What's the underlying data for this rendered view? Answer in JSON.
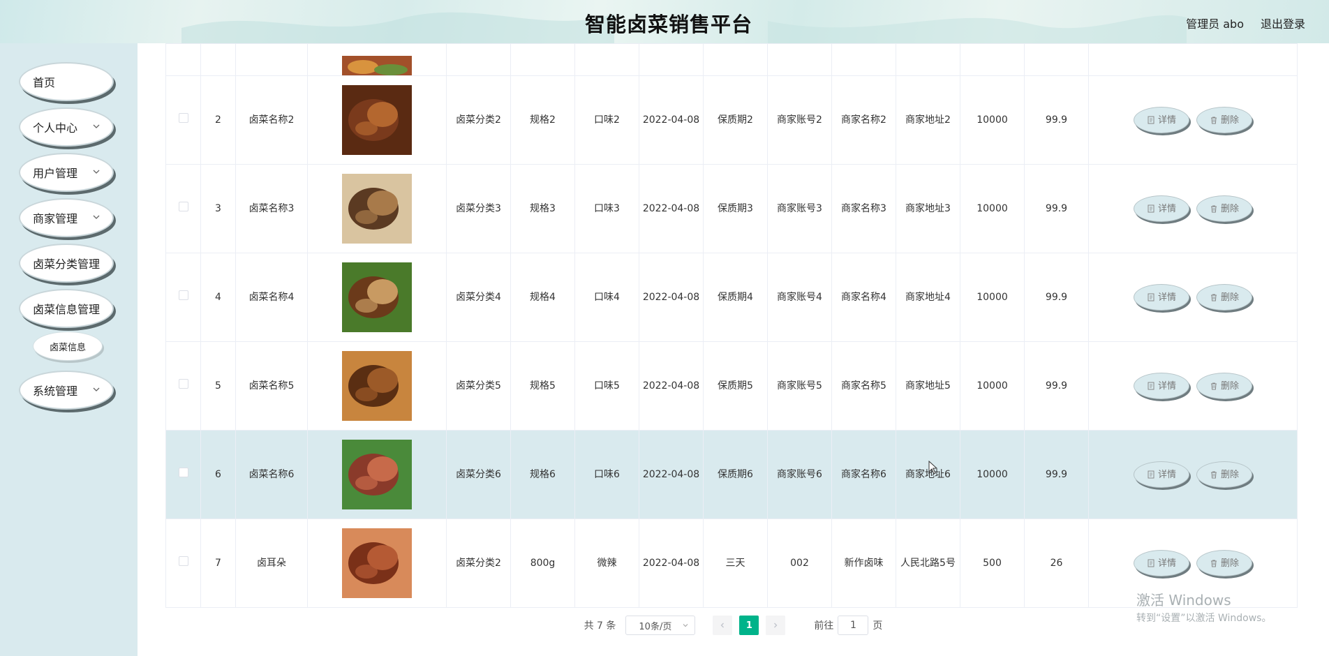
{
  "header": {
    "title": "智能卤菜销售平台",
    "user_label": "管理员 abo",
    "logout": "退出登录"
  },
  "sidebar": {
    "items": [
      {
        "label": "首页",
        "has_arrow": false
      },
      {
        "label": "个人中心",
        "has_arrow": true
      },
      {
        "label": "用户管理",
        "has_arrow": true
      },
      {
        "label": "商家管理",
        "has_arrow": true
      },
      {
        "label": "卤菜分类管理",
        "has_arrow": false
      },
      {
        "label": "卤菜信息管理",
        "has_arrow": false
      }
    ],
    "sub_item": "卤菜信息",
    "system": {
      "label": "系统管理",
      "has_arrow": true
    }
  },
  "table": {
    "rows": [
      {
        "no": "2",
        "name": "卤菜名称2",
        "category": "卤菜分类2",
        "spec": "规格2",
        "flavor": "口味2",
        "date": "2022-04-08",
        "shelf": "保质期2",
        "account": "商家账号2",
        "merchant": "商家名称2",
        "address": "商家地址2",
        "stock": "10000",
        "price": "99.9"
      },
      {
        "no": "3",
        "name": "卤菜名称3",
        "category": "卤菜分类3",
        "spec": "规格3",
        "flavor": "口味3",
        "date": "2022-04-08",
        "shelf": "保质期3",
        "account": "商家账号3",
        "merchant": "商家名称3",
        "address": "商家地址3",
        "stock": "10000",
        "price": "99.9"
      },
      {
        "no": "4",
        "name": "卤菜名称4",
        "category": "卤菜分类4",
        "spec": "规格4",
        "flavor": "口味4",
        "date": "2022-04-08",
        "shelf": "保质期4",
        "account": "商家账号4",
        "merchant": "商家名称4",
        "address": "商家地址4",
        "stock": "10000",
        "price": "99.9"
      },
      {
        "no": "5",
        "name": "卤菜名称5",
        "category": "卤菜分类5",
        "spec": "规格5",
        "flavor": "口味5",
        "date": "2022-04-08",
        "shelf": "保质期5",
        "account": "商家账号5",
        "merchant": "商家名称5",
        "address": "商家地址5",
        "stock": "10000",
        "price": "99.9"
      },
      {
        "no": "6",
        "name": "卤菜名称6",
        "category": "卤菜分类6",
        "spec": "规格6",
        "flavor": "口味6",
        "date": "2022-04-08",
        "shelf": "保质期6",
        "account": "商家账号6",
        "merchant": "商家名称6",
        "address": "商家地址6",
        "stock": "10000",
        "price": "99.9"
      },
      {
        "no": "7",
        "name": "卤耳朵",
        "category": "卤菜分类2",
        "spec": "800g",
        "flavor": "微辣",
        "date": "2022-04-08",
        "shelf": "三天",
        "account": "002",
        "merchant": "新作卤味",
        "address": "人民北路5号",
        "stock": "500",
        "price": "26"
      }
    ],
    "detail_label": "详情",
    "delete_label": "删除",
    "highlighted_row": 4
  },
  "pagination": {
    "total": "共 7 条",
    "page_size": "10条/页",
    "current_page": "1",
    "goto_prefix": "前往",
    "goto_value": "1",
    "goto_suffix": "页"
  },
  "watermark": {
    "line1": "激活 Windows",
    "line2": "转到“设置”以激活 Windows。"
  },
  "colors": {
    "accent": "#00b38a",
    "sidebar_bg": "#d9eaee",
    "highlight_row": "#d9eaee"
  }
}
